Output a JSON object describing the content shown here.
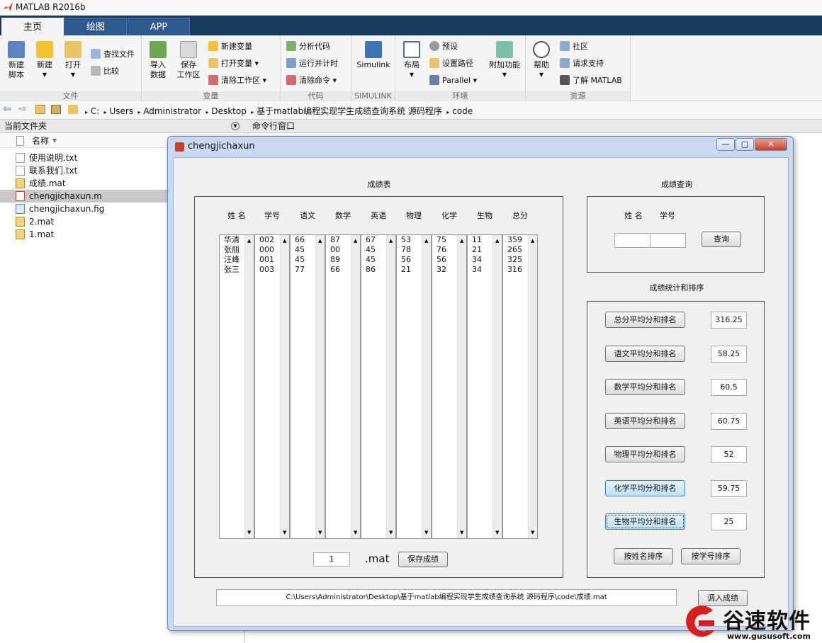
{
  "app": {
    "title": "MATLAB R2016b"
  },
  "tabs": [
    "主页",
    "绘图",
    "APP"
  ],
  "ribbon": {
    "file": {
      "label": "文件",
      "new_script": "新建\n脚本",
      "new": "新建",
      "open": "打开",
      "find_files": "查找文件",
      "compare": "比较"
    },
    "variable": {
      "label": "变量",
      "import": "导入\n数据",
      "save_ws": "保存\n工作区",
      "new_var": "新建变量",
      "open_var": "打开变量",
      "clear_ws": "清除工作区"
    },
    "code": {
      "label": "代码",
      "analyze": "分析代码",
      "run_time": "运行并计时",
      "clear_cmd": "清除命令"
    },
    "simulink": {
      "label": "SIMULINK",
      "simulink": "Simulink"
    },
    "env": {
      "label": "环境",
      "layout": "布局",
      "prefs": "预设",
      "set_path": "设置路径",
      "parallel": "Parallel",
      "addons": "附加功能"
    },
    "resources": {
      "label": "资源",
      "help": "帮助",
      "community": "社区",
      "support": "请求支持",
      "learn": "了解 MATLAB"
    }
  },
  "address": [
    "C:",
    "Users",
    "Administrator",
    "Desktop",
    "基于matlab编程实现学生成绩查询系统 源码程序",
    "code"
  ],
  "left_panel": {
    "title": "当前文件夹",
    "col_name": "名称",
    "files": [
      "使用说明.txt",
      "联系我们.txt",
      "成绩.mat",
      "chengjichaxun.m",
      "chengjichaxun.fig",
      "2.mat",
      "1.mat"
    ]
  },
  "cmd": {
    "title": "命令行窗口"
  },
  "figure": {
    "title": "chengjichaxun",
    "table_title": "成绩表",
    "headers": [
      "姓 名",
      "学号",
      "语文",
      "数学",
      "英语",
      "物理",
      "化学",
      "生物",
      "总分"
    ],
    "columns": [
      [
        "华清",
        "张丽",
        "汪峰",
        "张三"
      ],
      [
        "002",
        "000",
        "001",
        "003"
      ],
      [
        "66",
        "45",
        "45",
        "77"
      ],
      [
        "87",
        "00",
        "89",
        "66"
      ],
      [
        "67",
        "45",
        "45",
        "86"
      ],
      [
        "53",
        "78",
        "56",
        "21"
      ],
      [
        "75",
        "76",
        "56",
        "32"
      ],
      [
        "11",
        "21",
        "34",
        "34"
      ],
      [
        "359",
        "265",
        "325",
        "316"
      ]
    ],
    "file_num": "1",
    "file_ext": ".mat",
    "save_btn": "保存成绩",
    "query_title": "成绩查询",
    "query_name_label": "姓 名",
    "query_id_label": "学号",
    "query_btn": "查询",
    "stats_title": "成绩统计和排序",
    "stats": [
      {
        "label": "总分平均分和排名",
        "value": "316.25"
      },
      {
        "label": "语文平均分和排名",
        "value": "58.25"
      },
      {
        "label": "数学平均分和排名",
        "value": "60.5"
      },
      {
        "label": "英语平均分和排名",
        "value": "60.75"
      },
      {
        "label": "物理平均分和排名",
        "value": "52"
      },
      {
        "label": "化学平均分和排名",
        "value": "59.75"
      },
      {
        "label": "生物平均分和排名",
        "value": "25"
      }
    ],
    "sort_name_btn": "按姓名排序",
    "sort_id_btn": "按学号排序",
    "path": "C:\\Users\\Administrator\\Desktop\\基于matlab编程实现学生成绩查询系统 源码程序\\code\\成绩.mat",
    "import_btn": "调入成绩"
  },
  "watermark": {
    "brand": "谷速软件",
    "url": "www.gususoft.com"
  },
  "colors": {
    "tabbar": "#173a63",
    "highlight_btn": "#bfe0f7",
    "watermark": "#d81e1e"
  }
}
